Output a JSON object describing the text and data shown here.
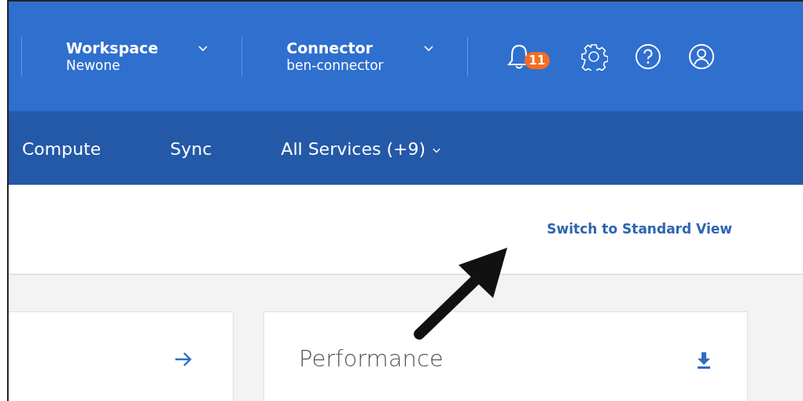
{
  "header": {
    "selectors": [
      {
        "label": "Workspace",
        "value": "Newone"
      },
      {
        "label": "Connector",
        "value": "ben-connector"
      }
    ],
    "notifications": {
      "count": "11"
    }
  },
  "nav": {
    "items": [
      {
        "label": "Compute",
        "kind": "link"
      },
      {
        "label": "Sync",
        "kind": "link"
      },
      {
        "label": "All Services (+9)",
        "kind": "dropdown"
      }
    ]
  },
  "view_switch": {
    "label": "Switch to Standard View"
  },
  "cards": [
    {
      "kind": "arrow"
    },
    {
      "title": "Performance",
      "kind": "download"
    }
  ]
}
